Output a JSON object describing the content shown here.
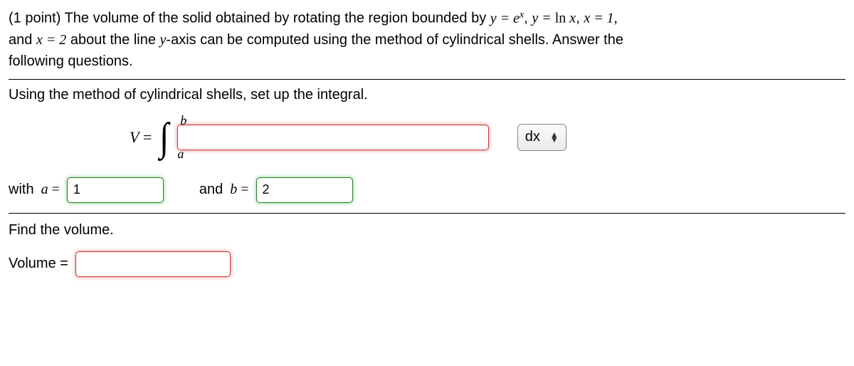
{
  "problem": {
    "points_prefix": "(1 point)",
    "line1_before": " The volume of the solid obtained by rotating the region bounded by ",
    "eq1": "y = e",
    "eq1_sup": "x",
    "comma1": ", ",
    "eq2_lhs": "y = ",
    "eq2_rhs_fn": "ln ",
    "eq2_rhs_var": "x",
    "comma2": ", ",
    "eq3": "x = 1,",
    "line2_before": "and ",
    "eq4": "x = 2",
    "line2_after": " about the line ",
    "yaxis": "y",
    "line2_tail": "-axis can be computed using the method of cylindrical shells. Answer the",
    "line3": "following questions."
  },
  "part1": {
    "instruction": "Using the method of cylindrical shells, set up the integral.",
    "V_label_lhs": "V",
    "V_label_eq": " = ",
    "integral_b": "b",
    "integral_a": "a",
    "integrand_value": "",
    "dx_label": "dx",
    "with_a": "with ",
    "a_var": "a",
    "a_eq": " = ",
    "a_value": "1",
    "and_b": "and ",
    "b_var": "b",
    "b_eq": " = ",
    "b_value": "2"
  },
  "part2": {
    "instruction": "Find the volume.",
    "volume_label": "Volume = ",
    "volume_value": ""
  }
}
